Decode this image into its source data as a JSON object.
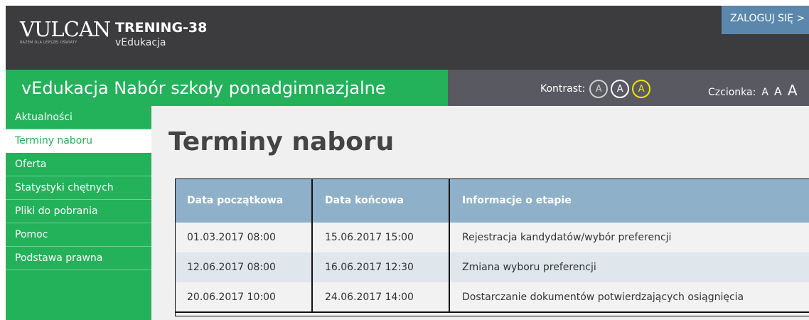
{
  "header": {
    "logo_text": "VULCAN",
    "logo_tagline": "RAZEM DLA LEPSZEJ OŚWIATY",
    "unit_name": "TRENING-38",
    "unit_sub": "vEdukacja",
    "login_label": "ZALOGUJ SIĘ >"
  },
  "titlebar": {
    "app_title": "vEdukacja Nabór szkoły ponadgimnazjalne",
    "contrast_label": "Kontrast:",
    "contrast_options": [
      "A",
      "A",
      "A"
    ],
    "font_label": "Czcionka:",
    "font_options": [
      "A",
      "A",
      "A"
    ]
  },
  "sidebar": {
    "items": [
      {
        "label": "Aktualności"
      },
      {
        "label": "Terminy naboru"
      },
      {
        "label": "Oferta"
      },
      {
        "label": "Statystyki chętnych"
      },
      {
        "label": "Pliki do pobrania"
      },
      {
        "label": "Pomoc"
      },
      {
        "label": "Podstawa prawna"
      }
    ],
    "active_index": 1
  },
  "main": {
    "title": "Terminy naboru",
    "table": {
      "headers": [
        "Data początkowa",
        "Data końcowa",
        "Informacje o etapie"
      ],
      "rows": [
        [
          "01.03.2017 08:00",
          "15.06.2017 15:00",
          "Rejestracja kandydatów/wybór preferencji"
        ],
        [
          "12.06.2017 08:00",
          "16.06.2017 12:30",
          "Zmiana wyboru preferencji"
        ],
        [
          "20.06.2017 10:00",
          "24.06.2017 14:00",
          "Dostarczanie dokumentów potwierdzających osiągnięcia"
        ]
      ]
    }
  },
  "colors": {
    "brand_green": "#23b25a",
    "header_dark": "#3c3c3e",
    "titlebar_gray": "#595961",
    "login_blue": "#5b87ad",
    "table_header": "#8fb0c9",
    "contrast_yellow": "#f2e30a"
  }
}
